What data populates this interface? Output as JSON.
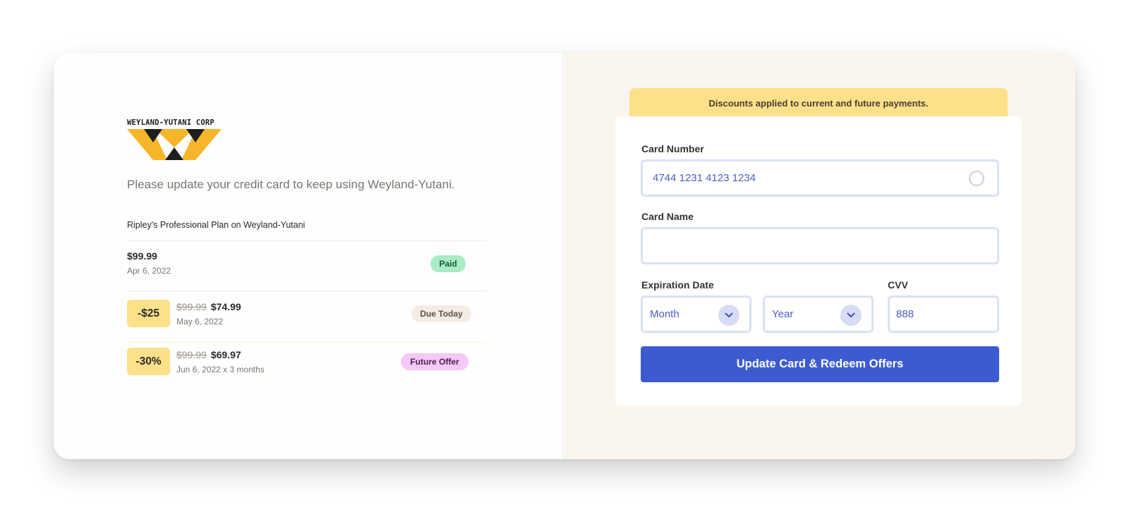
{
  "brand": {
    "logo_text": "WEYLAND-YUTANI CORP",
    "colors": {
      "logo_yellow": "#f7b52a",
      "logo_dark": "#1e1e1e"
    }
  },
  "left": {
    "intro": "Please update your credit card to keep using Weyland-Yutani.",
    "plan_title": "Ripley's Professional Plan on Weyland-Yutani",
    "payments": [
      {
        "price": "$99.99",
        "date": "Apr 6, 2022",
        "status": "Paid"
      },
      {
        "discount": "-$25",
        "old_price": "$99.99",
        "price": "$74.99",
        "date": "May 6, 2022",
        "status": "Due Today"
      },
      {
        "discount": "-30%",
        "old_price": "$99.99",
        "price": "$69.97",
        "date": "Jun 6, 2022 x 3 months",
        "status": "Future Offer"
      }
    ]
  },
  "right": {
    "banner": "Discounts applied to current and future payments.",
    "card_number_label": "Card Number",
    "card_number_value": "4744 1231 4123 1234",
    "card_name_label": "Card Name",
    "card_name_value": "",
    "expiration_label": "Expiration Date",
    "month_value": "Month",
    "year_value": "Year",
    "cvv_label": "CVV",
    "cvv_value": "888",
    "submit_label": "Update Card & Redeem Offers",
    "colors": {
      "accent": "#3d5bd1",
      "banner": "#fde08a"
    }
  }
}
